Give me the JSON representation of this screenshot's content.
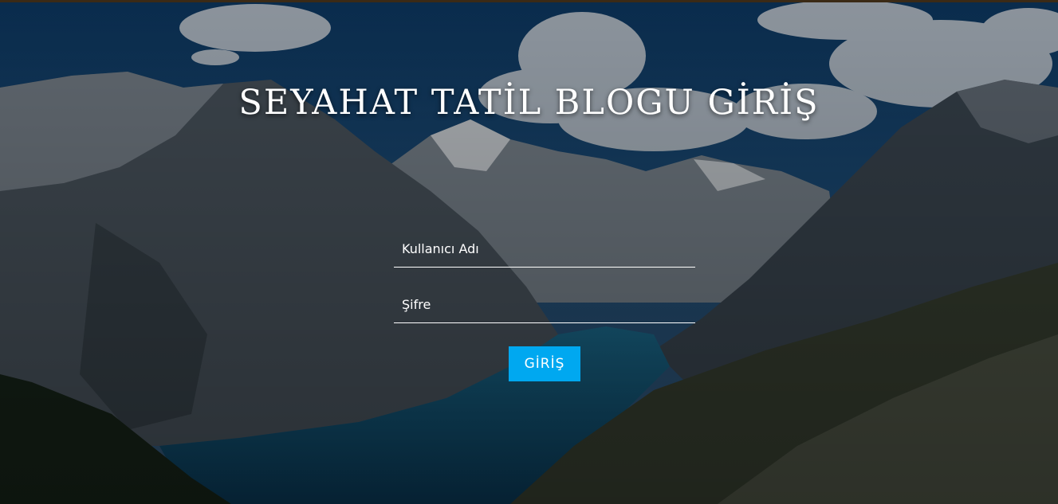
{
  "page": {
    "title": "SEYAHAT TATİL BLOGU GİRİŞ"
  },
  "login_form": {
    "username_placeholder": "Kullanıcı Adı",
    "username_value": "",
    "password_placeholder": "Şifre",
    "password_value": "",
    "submit_label": "GİRİŞ"
  },
  "colors": {
    "button_background": "#00a8f0",
    "text": "#ffffff",
    "overlay": "#0d1f33"
  },
  "background": {
    "description_icon": "mountain-lake-background"
  }
}
